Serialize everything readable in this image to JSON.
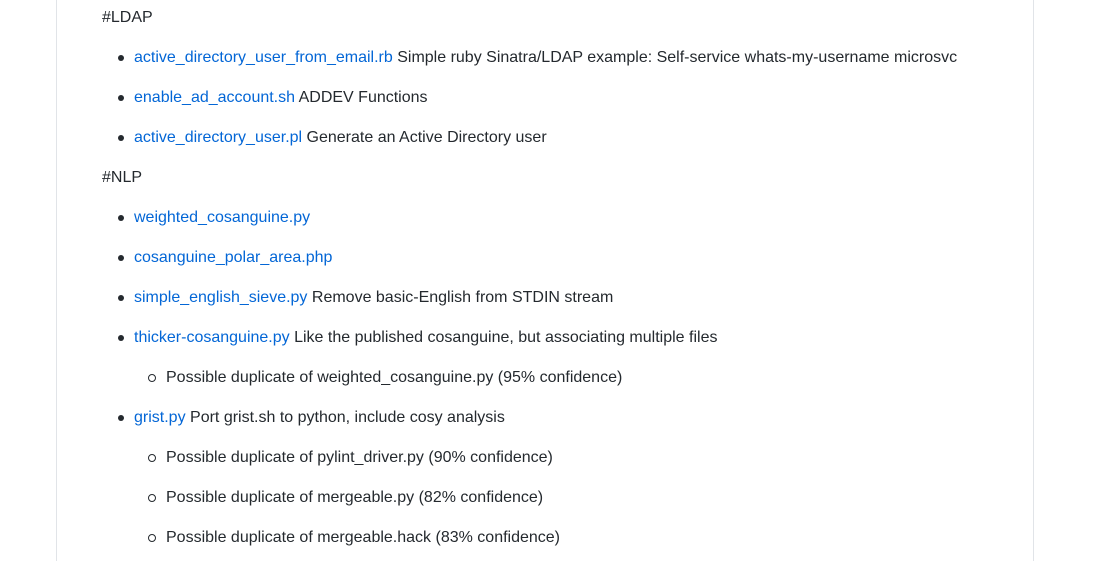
{
  "sections": [
    {
      "heading": "#LDAP",
      "items": [
        {
          "link": "active_directory_user_from_email.rb",
          "desc": " Simple ruby Sinatra/LDAP example: Self-service whats-my-username microsvc"
        },
        {
          "link": "enable_ad_account.sh",
          "desc": " ADDEV Functions"
        },
        {
          "link": "active_directory_user.pl",
          "desc": " Generate an Active Directory user"
        }
      ]
    },
    {
      "heading": "#NLP",
      "items": [
        {
          "link": "weighted_cosanguine.py",
          "desc": ""
        },
        {
          "link": "cosanguine_polar_area.php",
          "desc": ""
        },
        {
          "link": "simple_english_sieve.py",
          "desc": " Remove basic-English from STDIN stream"
        },
        {
          "link": "thicker-cosanguine.py",
          "desc": " Like the published cosanguine, but associating multiple files",
          "subitems": [
            "Possible duplicate of weighted_cosanguine.py (95% confidence)"
          ]
        },
        {
          "link": "grist.py",
          "desc": " Port grist.sh to python, include cosy analysis",
          "subitems": [
            "Possible duplicate of pylint_driver.py (90% confidence)",
            "Possible duplicate of mergeable.py (82% confidence)",
            "Possible duplicate of mergeable.hack (83% confidence)"
          ]
        }
      ]
    }
  ]
}
